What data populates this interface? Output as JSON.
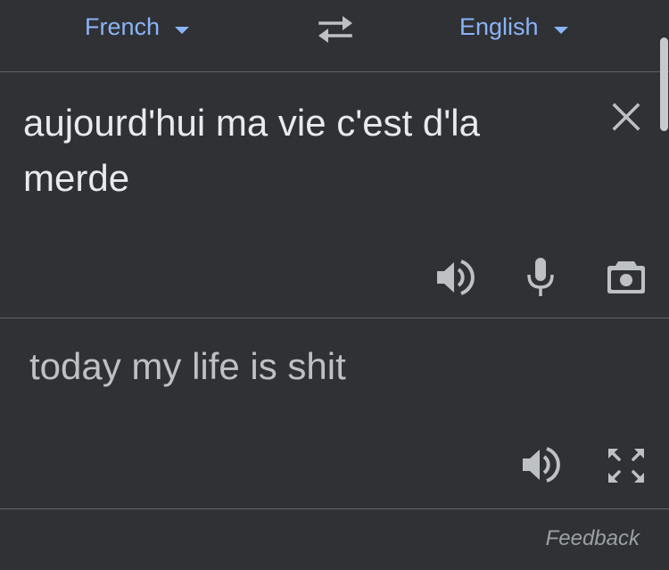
{
  "lang_bar": {
    "source_language": "French",
    "target_language": "English",
    "swap_icon": "swap-arrows-icon",
    "dropdown_icon": "caret-down-icon"
  },
  "source": {
    "text": "aujourd'hui ma vie c'est d'la merde",
    "icons": [
      "close-icon",
      "speaker-icon",
      "microphone-icon",
      "camera-icon"
    ]
  },
  "result": {
    "text": "today my life is shit",
    "icons": [
      "speaker-icon",
      "fullscreen-icon"
    ]
  },
  "footer": {
    "feedback_label": "Feedback"
  },
  "colors": {
    "background": "#303134",
    "accent": "#8ab4f8",
    "text_primary": "#e8eaed",
    "text_secondary": "#bdc1c6",
    "icon": "#bdc1c6",
    "divider": "#5f6368"
  }
}
